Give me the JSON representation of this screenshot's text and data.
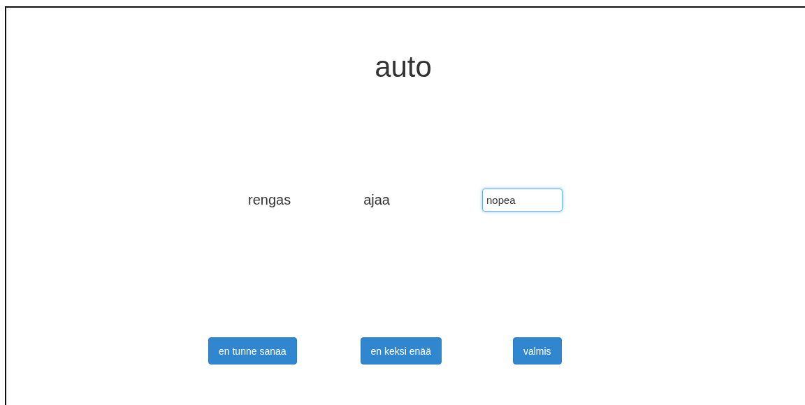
{
  "title": "auto",
  "words": [
    "rengas",
    "ajaa"
  ],
  "answer": {
    "value": "nopea",
    "focused": true
  },
  "buttons": [
    "en tunne sanaa",
    "en keksi enää",
    "valmis"
  ]
}
